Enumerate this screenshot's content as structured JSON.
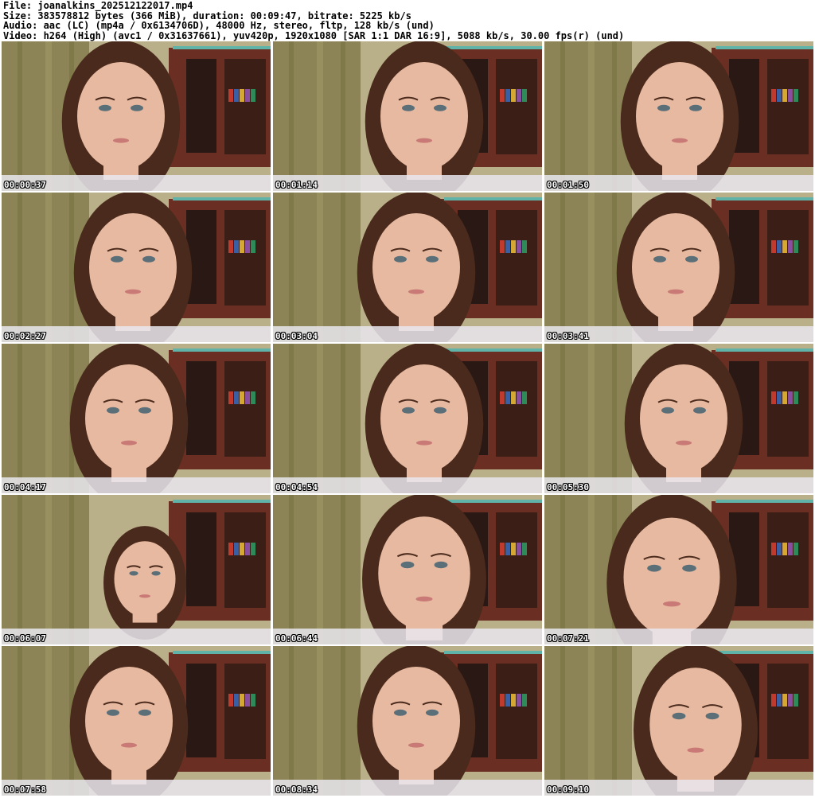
{
  "header": {
    "file": "File: joanalkins_202512122017.mp4",
    "size": "Size: 383578812 bytes (366 MiB), duration: 00:09:47, bitrate: 5225 kb/s",
    "audio": "Audio: aac (LC) (mp4a / 0x6134706D), 48000 Hz, stereo, fltp, 128 kb/s (und)",
    "video": "Video: h264 (High) (avc1 / 0x31637661), yuv420p, 1920x1080 [SAR 1:1 DAR 16:9], 5088 kb/s, 30.00 fps(r) (und)"
  },
  "thumbnails": [
    {
      "timestamp": "00:00:37"
    },
    {
      "timestamp": "00:01:14"
    },
    {
      "timestamp": "00:01:50"
    },
    {
      "timestamp": "00:02:27"
    },
    {
      "timestamp": "00:03:04"
    },
    {
      "timestamp": "00:03:41"
    },
    {
      "timestamp": "00:04:17"
    },
    {
      "timestamp": "00:04:54"
    },
    {
      "timestamp": "00:05:30"
    },
    {
      "timestamp": "00:06:07"
    },
    {
      "timestamp": "00:06:44"
    },
    {
      "timestamp": "00:07:21"
    },
    {
      "timestamp": "00:07:58"
    },
    {
      "timestamp": "00:08:34"
    },
    {
      "timestamp": "00:09:10"
    }
  ],
  "colors": {
    "curtain": "#8c8456",
    "wall": "#b9b08a",
    "cabinet": "#6a2f22",
    "trim": "#5fb3a8",
    "skin": "#e7b9a0",
    "hair": "#4a2a1c",
    "top": "#e9e6ee"
  }
}
